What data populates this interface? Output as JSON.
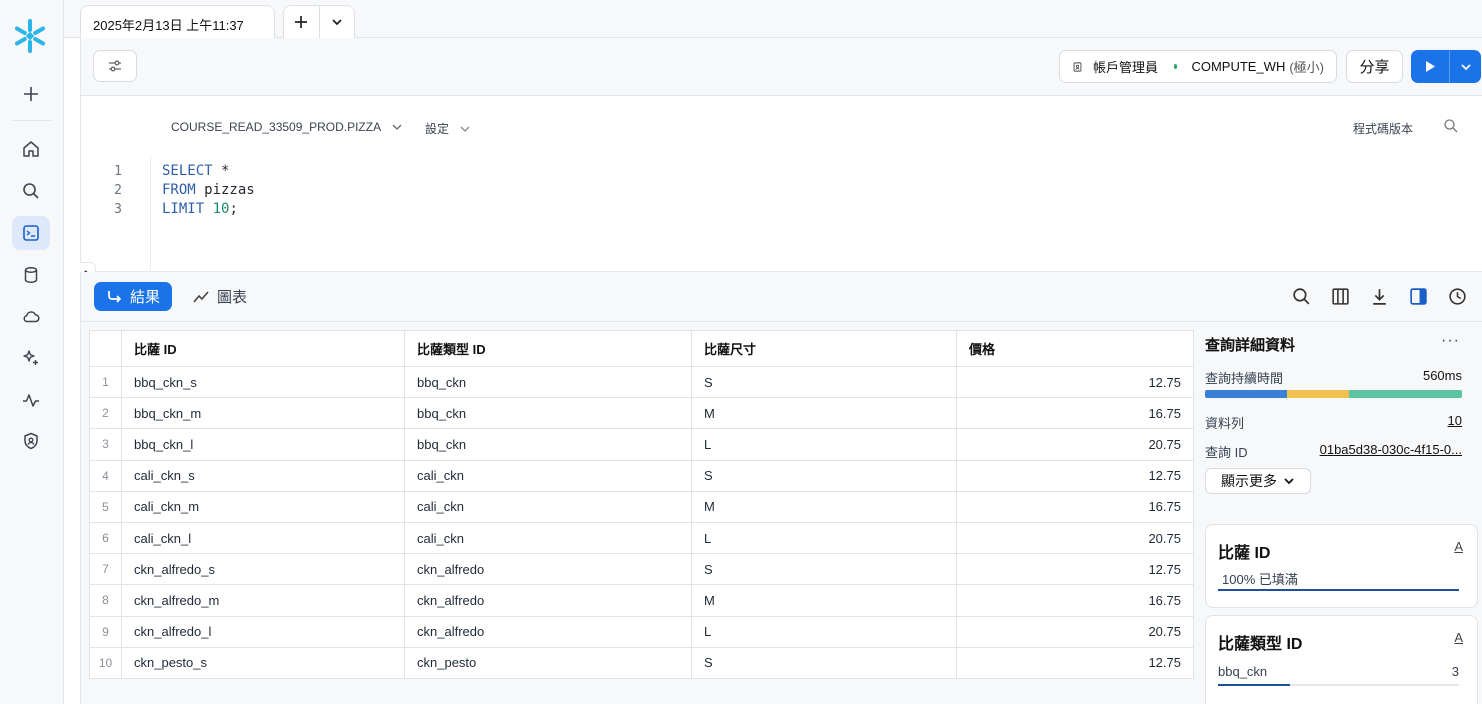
{
  "app": {
    "tab_title": "2025年2月13日 上午11:37"
  },
  "toolbar": {
    "role_label": "帳戶管理員",
    "warehouse_name": "COMPUTE_WH",
    "warehouse_size": "(極小)",
    "share_label": "分享"
  },
  "editor": {
    "database_context": "COURSE_READ_33509_PROD.PIZZA",
    "settings_label": "設定",
    "code_versions_label": "程式碼版本",
    "lines": [
      {
        "num": "1",
        "kw": "SELECT",
        "rest": " *"
      },
      {
        "num": "2",
        "kw": "FROM",
        "rest": " pizzas"
      },
      {
        "num": "3",
        "kw": "LIMIT",
        "rest": " ",
        "num_val": "10",
        "end": ";"
      }
    ]
  },
  "results": {
    "results_tab_label": "結果",
    "chart_tab_label": "圖表",
    "columns": [
      "比薩 ID",
      "比薩類型 ID",
      "比薩尺寸",
      "價格"
    ],
    "rows": [
      {
        "n": "1",
        "id": "bbq_ckn_s",
        "type": "bbq_ckn",
        "size": "S",
        "price": "12.75"
      },
      {
        "n": "2",
        "id": "bbq_ckn_m",
        "type": "bbq_ckn",
        "size": "M",
        "price": "16.75"
      },
      {
        "n": "3",
        "id": "bbq_ckn_l",
        "type": "bbq_ckn",
        "size": "L",
        "price": "20.75"
      },
      {
        "n": "4",
        "id": "cali_ckn_s",
        "type": "cali_ckn",
        "size": "S",
        "price": "12.75"
      },
      {
        "n": "5",
        "id": "cali_ckn_m",
        "type": "cali_ckn",
        "size": "M",
        "price": "16.75"
      },
      {
        "n": "6",
        "id": "cali_ckn_l",
        "type": "cali_ckn",
        "size": "L",
        "price": "20.75"
      },
      {
        "n": "7",
        "id": "ckn_alfredo_s",
        "type": "ckn_alfredo",
        "size": "S",
        "price": "12.75"
      },
      {
        "n": "8",
        "id": "ckn_alfredo_m",
        "type": "ckn_alfredo",
        "size": "M",
        "price": "16.75"
      },
      {
        "n": "9",
        "id": "ckn_alfredo_l",
        "type": "ckn_alfredo",
        "size": "L",
        "price": "20.75"
      },
      {
        "n": "10",
        "id": "ckn_pesto_s",
        "type": "ckn_pesto",
        "size": "S",
        "price": "12.75"
      }
    ]
  },
  "details": {
    "title": "查詢詳細資料",
    "duration_label": "查詢持續時間",
    "duration_value": "560ms",
    "rows_label": "資料列",
    "rows_value": "10",
    "query_id_label": "查詢 ID",
    "query_id_value": "01ba5d38-030c-4f15-0...",
    "show_more_label": "顯示更多",
    "column_cards": [
      {
        "title": "比薩 ID",
        "type_glyph": "A",
        "stat": "100% 已填滿",
        "fill": 1.0
      },
      {
        "title": "比薩類型 ID",
        "type_glyph": "A",
        "top_value": "bbq_ckn",
        "top_count": "3",
        "fill": 0.3
      }
    ]
  },
  "colors": {
    "accent": "#1a73e8",
    "duration_segments": [
      "#3b7fd9",
      "#f2c14e",
      "#5bc4a0"
    ]
  }
}
